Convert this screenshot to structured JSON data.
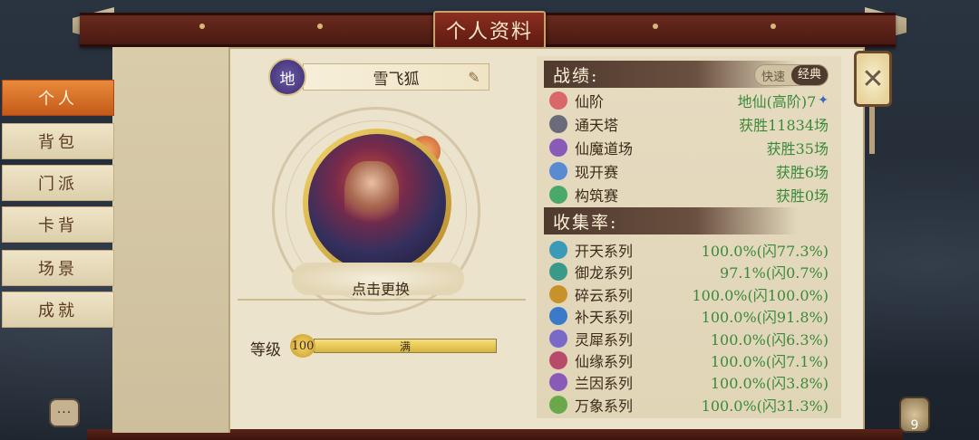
{
  "window": {
    "title": "个人资料"
  },
  "sidebar": {
    "items": [
      {
        "label": "个人",
        "active": true
      },
      {
        "label": "背包",
        "active": false
      },
      {
        "label": "门派",
        "active": false
      },
      {
        "label": "卡背",
        "active": false
      },
      {
        "label": "场景",
        "active": false
      },
      {
        "label": "成就",
        "active": false
      }
    ]
  },
  "profile": {
    "rank_badge": "地",
    "name": "雪飞狐",
    "change_avatar_label": "点击更换",
    "level_label": "等级",
    "level_value": "100",
    "level_bar_text": "满",
    "level_progress": 1.0
  },
  "record": {
    "title": "战绩:",
    "toggle": {
      "options": [
        "快速",
        "经典"
      ],
      "selected": "经典"
    },
    "rows": [
      {
        "icon": "xianjie-icon",
        "color": "#d9676a",
        "label": "仙阶",
        "value": "地仙(高阶)7"
      },
      {
        "icon": "tower-icon",
        "color": "#6a6a7a",
        "label": "通天塔",
        "value": "获胜11834场"
      },
      {
        "icon": "demon-path-icon",
        "color": "#8a5ab8",
        "label": "仙魔道场",
        "value": "获胜35场"
      },
      {
        "icon": "open-match-icon",
        "color": "#5a8ad0",
        "label": "现开赛",
        "value": "获胜6场"
      },
      {
        "icon": "build-match-icon",
        "color": "#4aa86a",
        "label": "构筑赛",
        "value": "获胜0场"
      }
    ]
  },
  "collection": {
    "title": "收集率:",
    "rows": [
      {
        "icon": "kaitian-icon",
        "color": "#3a9ab8",
        "label": "开天系列",
        "value": "100.0%(闪77.3%)"
      },
      {
        "icon": "yulong-icon",
        "color": "#3a9a8a",
        "label": "御龙系列",
        "value": "97.1%(闪0.7%)"
      },
      {
        "icon": "suiyun-icon",
        "color": "#c8922a",
        "label": "碎云系列",
        "value": "100.0%(闪100.0%)"
      },
      {
        "icon": "butian-icon",
        "color": "#3a7ac8",
        "label": "补天系列",
        "value": "100.0%(闪91.8%)"
      },
      {
        "icon": "lingxi-icon",
        "color": "#7a6ac8",
        "label": "灵犀系列",
        "value": "100.0%(闪6.3%)"
      },
      {
        "icon": "xianyuan-icon",
        "color": "#b84a6a",
        "label": "仙缘系列",
        "value": "100.0%(闪7.1%)"
      },
      {
        "icon": "lanyin-icon",
        "color": "#8a5ab8",
        "label": "兰因系列",
        "value": "100.0%(闪3.8%)"
      },
      {
        "icon": "wanxiang-icon",
        "color": "#6aa84a",
        "label": "万象系列",
        "value": "100.0%(闪31.3%)"
      }
    ]
  },
  "controls": {
    "close_glyph": "✕",
    "chat_glyph": "···",
    "bag_count": "9"
  }
}
